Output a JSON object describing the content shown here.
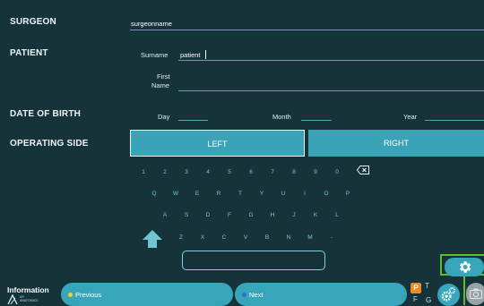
{
  "form": {
    "surgeon": {
      "label": "SURGEON",
      "value": "surgeonname"
    },
    "patient": {
      "label": "PATIENT",
      "surname_label": "Surname",
      "surname_value": "patient",
      "first_name_label_line1": "First",
      "first_name_label_line2": "Name",
      "first_name_value": ""
    },
    "date_of_birth": {
      "label": "DATE OF BIRTH",
      "day_label": "Day",
      "month_label": "Month",
      "year_label": "Year"
    },
    "operating_side": {
      "label": "OPERATING SIDE",
      "left_label": "LEFT",
      "right_label": "RIGHT",
      "selected": "LEFT"
    }
  },
  "keyboard": {
    "row1": [
      "1",
      "2",
      "3",
      "4",
      "5",
      "6",
      "7",
      "8",
      "9",
      "0"
    ],
    "row2": [
      "Q",
      "W",
      "E",
      "R",
      "T",
      "Y",
      "U",
      "I",
      "O",
      "P"
    ],
    "row3": [
      "A",
      "S",
      "D",
      "F",
      "G",
      "H",
      "J",
      "K",
      "L"
    ],
    "row4": [
      "Z",
      "X",
      "C",
      "V",
      "B",
      "N",
      "M",
      "-"
    ]
  },
  "footer": {
    "section_title": "Information",
    "logo_line1": "MY",
    "logo_line2": "ANATOMICS",
    "previous_label": "Previous",
    "next_label": "Next",
    "badge_p": "P",
    "letter_t": "T",
    "letter_f": "F",
    "letter_g": "G"
  },
  "icons": [
    "backspace-icon",
    "shift-arrow-icon",
    "settings-gear-icon",
    "gears-icon",
    "camera-icon",
    "logo-icon"
  ],
  "colors": {
    "background": "#16333a",
    "accent": "#38a6ba",
    "key_text": "#7fc6d2",
    "previous_dot": "#f2d21b",
    "next_dot": "#2f6fd6",
    "highlight_frame": "#5fbf2a",
    "badge": "#f08a1c"
  }
}
